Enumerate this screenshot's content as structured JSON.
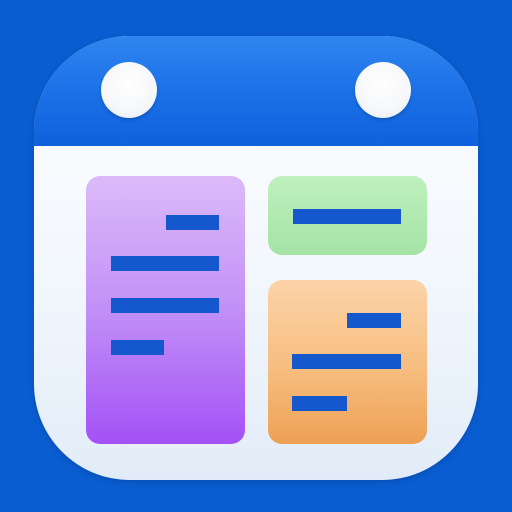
{
  "app_icon": {
    "depicts": "calendar-with-event-blocks",
    "colors": {
      "background": "#0a5dd0",
      "header": "#1a6fe6",
      "card": "#f2f7fd",
      "ring": "#f4f6f9",
      "event_purple": "#c190f7",
      "event_green": "#a4e3a4",
      "event_orange": "#f6bd7e",
      "text_line": "#1558cd"
    },
    "events": [
      {
        "color_name": "purple",
        "lines": 4
      },
      {
        "color_name": "green",
        "lines": 1
      },
      {
        "color_name": "orange",
        "lines": 3
      }
    ]
  }
}
